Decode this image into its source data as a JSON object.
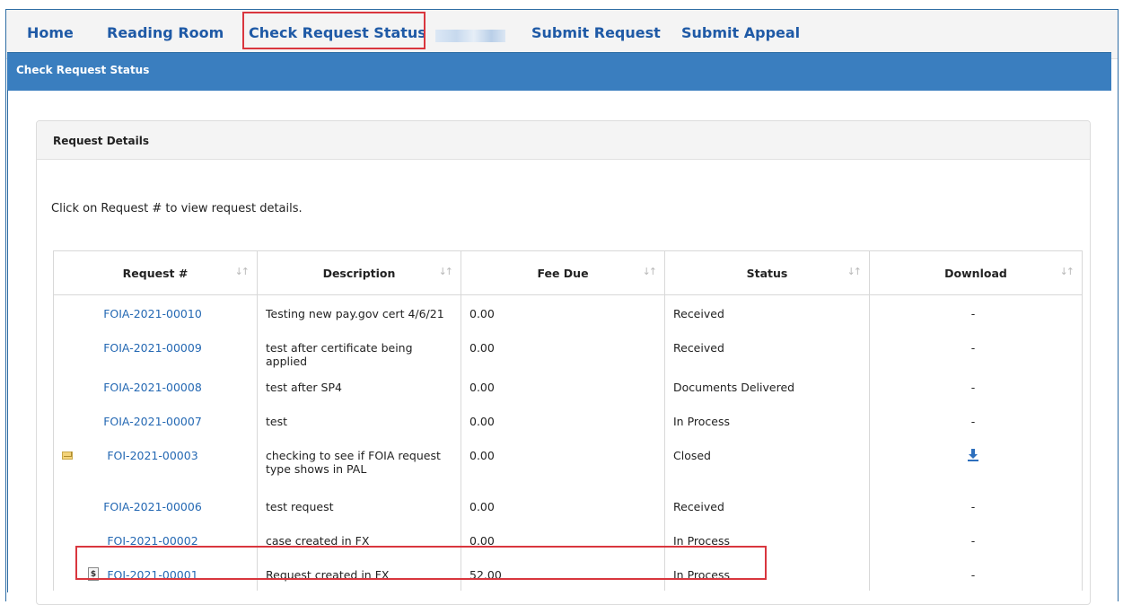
{
  "nav": {
    "items": [
      "Home",
      "Reading Room",
      "Check Request Status",
      "Submit Request",
      "Submit Appeal"
    ]
  },
  "page_title": "Check Request Status",
  "panel": {
    "title": "Request Details",
    "instruction": "Click on Request # to view request details."
  },
  "table": {
    "headers": [
      "Request #",
      "Description",
      "Fee Due",
      "Status",
      "Download"
    ],
    "sort_icon": "sort-icon",
    "rows": [
      {
        "request": "FOIA-2021-00010",
        "description": "Testing new pay.gov cert 4/6/21",
        "fee": "0.00",
        "status": "Received",
        "download": "-",
        "icon": ""
      },
      {
        "request": "FOIA-2021-00009",
        "description": "test after certificate being applied",
        "fee": "0.00",
        "status": "Received",
        "download": "-",
        "icon": ""
      },
      {
        "request": "FOIA-2021-00008",
        "description": "test after SP4",
        "fee": "0.00",
        "status": "Documents Delivered",
        "download": "-",
        "icon": ""
      },
      {
        "request": "FOIA-2021-00007",
        "description": "test",
        "fee": "0.00",
        "status": "In Process",
        "download": "-",
        "icon": ""
      },
      {
        "request": "FOI-2021-00003",
        "description": "checking to see if FOIA request type shows in PAL",
        "fee": "0.00",
        "status": "Closed",
        "download": "download-icon",
        "icon": "envelope-icon"
      },
      {
        "request": "FOIA-2021-00006",
        "description": "test request",
        "fee": "0.00",
        "status": "Received",
        "download": "-",
        "icon": ""
      },
      {
        "request": "FOI-2021-00002",
        "description": "case created in FX",
        "fee": "0.00",
        "status": "In Process",
        "download": "-",
        "icon": ""
      },
      {
        "request": "FOI-2021-00001",
        "description": "Request created in FX",
        "fee": "52.00",
        "status": "In Process",
        "download": "-",
        "icon": "dollar-icon"
      }
    ]
  },
  "colors": {
    "link": "#2468b3",
    "nav_text": "#1f5aa6",
    "header_bar": "#3a7ebf",
    "highlight_box": "#d9363e"
  }
}
